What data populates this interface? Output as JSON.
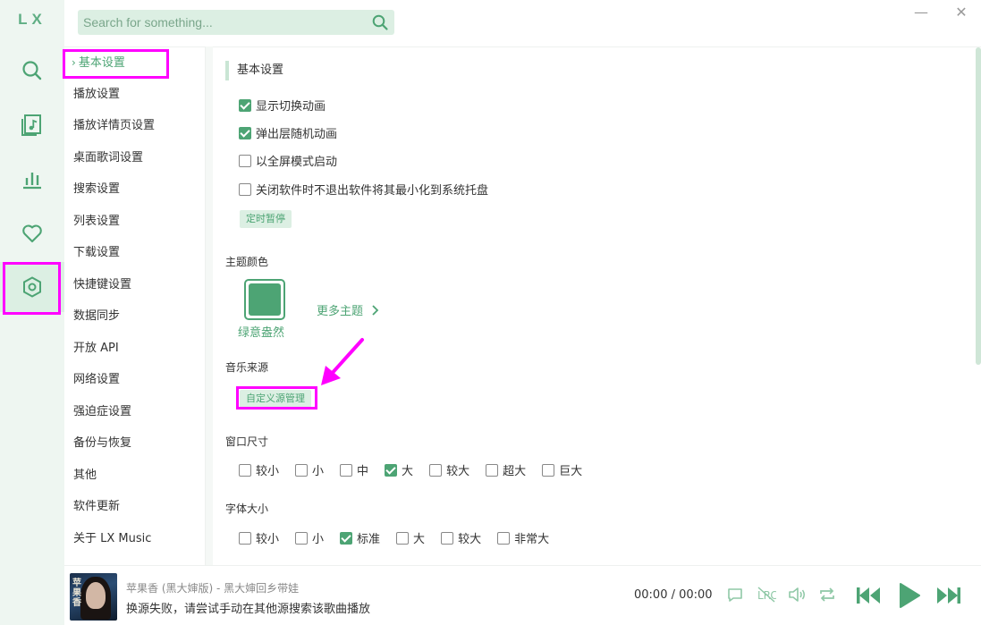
{
  "app": {
    "logo": "LX"
  },
  "search": {
    "placeholder": "Search for something..."
  },
  "window": {
    "minimize": "—",
    "close": "✕"
  },
  "nav": {
    "items": [
      {
        "label": "基本设置",
        "active": true
      },
      {
        "label": "播放设置"
      },
      {
        "label": "播放详情页设置"
      },
      {
        "label": "桌面歌词设置"
      },
      {
        "label": "搜索设置"
      },
      {
        "label": "列表设置"
      },
      {
        "label": "下载设置"
      },
      {
        "label": "快捷键设置"
      },
      {
        "label": "数据同步"
      },
      {
        "label": "开放 API"
      },
      {
        "label": "网络设置"
      },
      {
        "label": "强迫症设置"
      },
      {
        "label": "备份与恢复"
      },
      {
        "label": "其他"
      },
      {
        "label": "软件更新"
      },
      {
        "label": "关于 LX Music"
      }
    ]
  },
  "basic": {
    "title": "基本设置",
    "options": [
      {
        "label": "显示切换动画",
        "checked": true
      },
      {
        "label": "弹出层随机动画",
        "checked": true
      },
      {
        "label": "以全屏模式启动",
        "checked": false
      },
      {
        "label": "关闭软件时不退出软件将其最小化到系统托盘",
        "checked": false
      }
    ],
    "timer_button": "定时暂停"
  },
  "theme": {
    "title": "主题颜色",
    "current": "绿意盎然",
    "current_color": "#4da474",
    "more": "更多主题"
  },
  "source": {
    "title": "音乐来源",
    "manage_button": "自定义源管理"
  },
  "window_size": {
    "title": "窗口尺寸",
    "options": [
      {
        "label": "较小",
        "checked": false
      },
      {
        "label": "小",
        "checked": false
      },
      {
        "label": "中",
        "checked": false
      },
      {
        "label": "大",
        "checked": true
      },
      {
        "label": "较大",
        "checked": false
      },
      {
        "label": "超大",
        "checked": false
      },
      {
        "label": "巨大",
        "checked": false
      }
    ]
  },
  "font_size": {
    "title": "字体大小",
    "options": [
      {
        "label": "较小",
        "checked": false
      },
      {
        "label": "小",
        "checked": false
      },
      {
        "label": "标准",
        "checked": true
      },
      {
        "label": "大",
        "checked": false
      },
      {
        "label": "较大",
        "checked": false
      },
      {
        "label": "非常大",
        "checked": false
      }
    ]
  },
  "player": {
    "song": "苹果香 (黑大婶版) - 黑大婶回乡带娃",
    "message": "换源失败，请尝试手动在其他源搜索该歌曲播放",
    "time": "00:00 / 00:00"
  },
  "colors": {
    "accent": "#4da474",
    "highlight": "#ff00ff",
    "rail_bg": "#eef6f1"
  }
}
